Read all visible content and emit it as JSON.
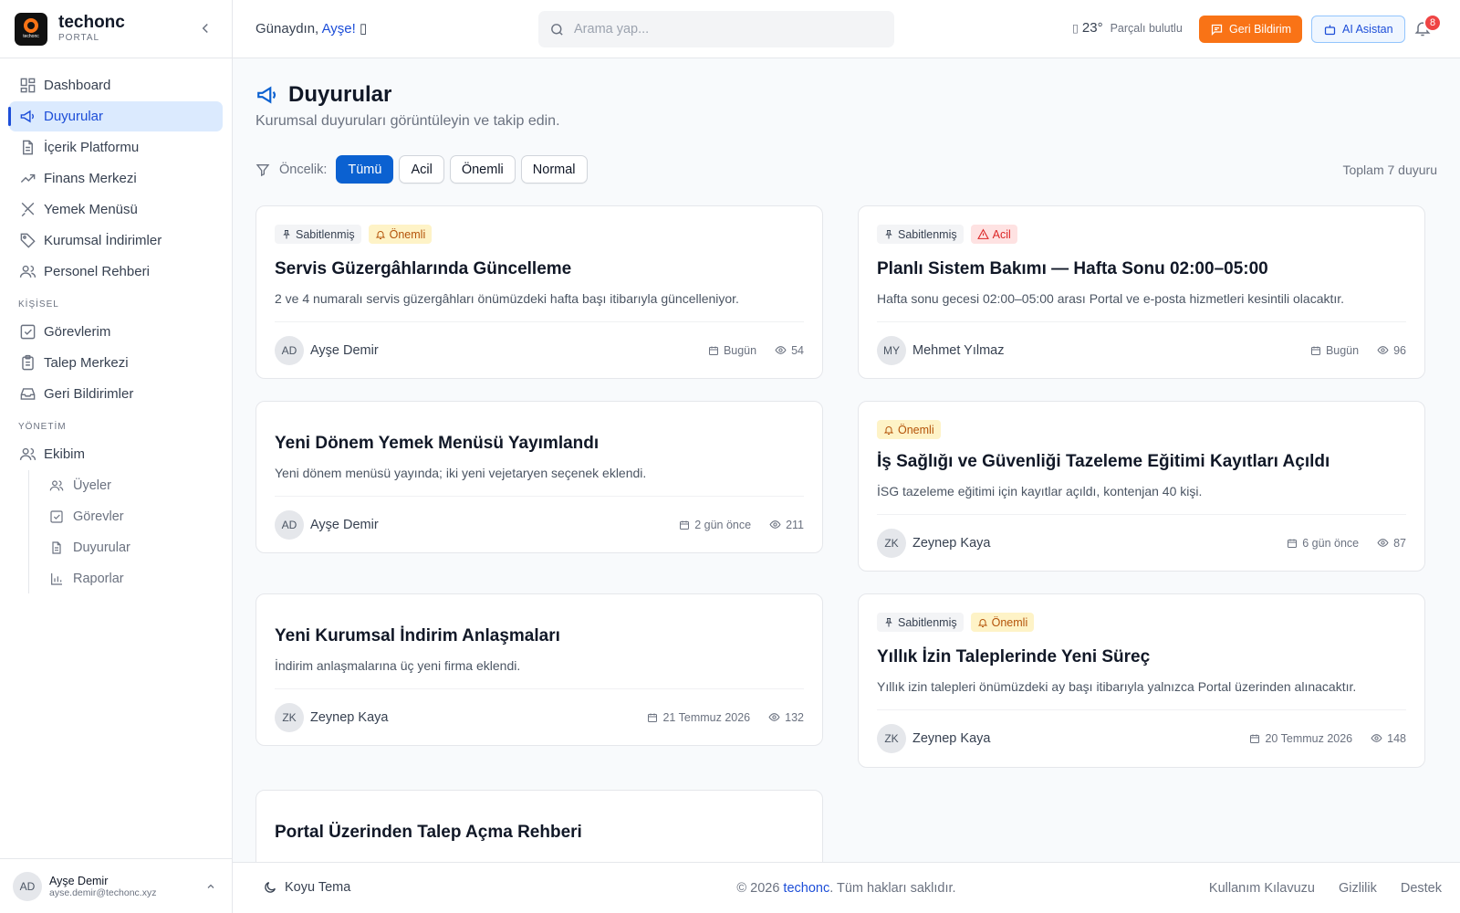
{
  "brand": {
    "name": "techonc",
    "sub": "PORTAL",
    "logo_text": "techonc"
  },
  "nav": {
    "main": [
      {
        "label": "Dashboard",
        "icon": "dashboard-icon"
      },
      {
        "label": "Duyurular",
        "icon": "megaphone-icon",
        "active": true
      },
      {
        "label": "İçerik Platformu",
        "icon": "document-icon"
      },
      {
        "label": "Finans Merkezi",
        "icon": "trend-icon"
      },
      {
        "label": "Yemek Menüsü",
        "icon": "utensils-icon"
      },
      {
        "label": "Kurumsal İndirimler",
        "icon": "tag-icon"
      },
      {
        "label": "Personel Rehberi",
        "icon": "users-icon"
      }
    ],
    "personal_heading": "KİŞİSEL",
    "personal": [
      {
        "label": "Görevlerim",
        "icon": "check-square-icon"
      },
      {
        "label": "Talep Merkezi",
        "icon": "clipboard-icon"
      },
      {
        "label": "Geri Bildirimler",
        "icon": "inbox-icon"
      }
    ],
    "admin_heading": "YÖNETİM",
    "admin": {
      "label": "Ekibim",
      "icon": "users-icon"
    },
    "admin_sub": [
      {
        "label": "Üyeler",
        "icon": "users-icon"
      },
      {
        "label": "Görevler",
        "icon": "check-square-icon"
      },
      {
        "label": "Duyurular",
        "icon": "document-icon"
      },
      {
        "label": "Raporlar",
        "icon": "bar-chart-icon"
      }
    ]
  },
  "user": {
    "initials": "AD",
    "name": "Ayşe Demir",
    "email": "ayse.demir@techonc.xyz"
  },
  "topbar": {
    "greeting": "Günaydın, ",
    "greeting_name": "Ayşe!",
    "greeting_end": " ▯",
    "search_placeholder": "Arama yap...",
    "weather_icon": "▯",
    "temperature": "23°",
    "weather": "Parçalı bulutlu",
    "feedback_button": "Geri Bildirim",
    "ai_button": "AI Asistan",
    "notifications": "8"
  },
  "page": {
    "title": "Duyurular",
    "subtitle": "Kurumsal duyuruları görüntüleyin ve takip edin.",
    "filter_label": "Öncelik:",
    "filters": [
      "Tümü",
      "Acil",
      "Önemli",
      "Normal"
    ],
    "active_filter": "Tümü",
    "total": "Toplam 7 duyuru"
  },
  "cards_left": [
    {
      "pinned": "Sabitlenmiş",
      "priority": "Önemli",
      "title": "Servis Güzergâhlarında Güncelleme",
      "desc": "2 ve 4 numaralı servis güzergâhları önümüzdeki hafta başı itibarıyla güncelleniyor.",
      "initials": "AD",
      "author": "Ayşe Demir",
      "date": "Bugün",
      "views": "54"
    },
    {
      "title": "Yeni Dönem Yemek Menüsü Yayımlandı",
      "desc": "Yeni dönem menüsü yayında; iki yeni vejetaryen seçenek eklendi.",
      "initials": "AD",
      "author": "Ayşe Demir",
      "date": "2 gün önce",
      "views": "211"
    },
    {
      "title": "Yeni Kurumsal İndirim Anlaşmaları",
      "desc": "İndirim anlaşmalarına üç yeni firma eklendi.",
      "initials": "ZK",
      "author": "Zeynep Kaya",
      "date": "21 Temmuz 2026",
      "views": "132"
    },
    {
      "title": "Portal Üzerinden Talep Açma Rehberi"
    }
  ],
  "cards_right": [
    {
      "pinned": "Sabitlenmiş",
      "priority": "Acil",
      "title": "Planlı Sistem Bakımı — Hafta Sonu 02:00–05:00",
      "desc": "Hafta sonu gecesi 02:00–05:00 arası Portal ve e-posta hizmetleri kesintili olacaktır.",
      "initials": "MY",
      "author": "Mehmet Yılmaz",
      "date": "Bugün",
      "views": "96"
    },
    {
      "priority": "Önemli",
      "title": "İş Sağlığı ve Güvenliği Tazeleme Eğitimi Kayıtları Açıldı",
      "desc": "İSG tazeleme eğitimi için kayıtlar açıldı, kontenjan 40 kişi.",
      "initials": "ZK",
      "author": "Zeynep Kaya",
      "date": "6 gün önce",
      "views": "87"
    },
    {
      "pinned": "Sabitlenmiş",
      "priority": "Önemli",
      "title": "Yıllık İzin Taleplerinde Yeni Süreç",
      "desc": "Yıllık izin talepleri önümüzdeki ay başı itibarıyla yalnızca Portal üzerinden alınacaktır.",
      "initials": "ZK",
      "author": "Zeynep Kaya",
      "date": "20 Temmuz 2026",
      "views": "148"
    }
  ],
  "footer": {
    "theme": "Koyu Tema",
    "copyright_pre": "© 2026 ",
    "copyright_brand": "techonc",
    "copyright_post": ". Tüm hakları saklıdır.",
    "links": [
      "Kullanım Kılavuzu",
      "Gizlilik",
      "Destek"
    ]
  },
  "colors": {
    "primary": "#0b61d1",
    "accent": "#f97316",
    "urgent": "#dc2626",
    "important": "#b45309"
  }
}
